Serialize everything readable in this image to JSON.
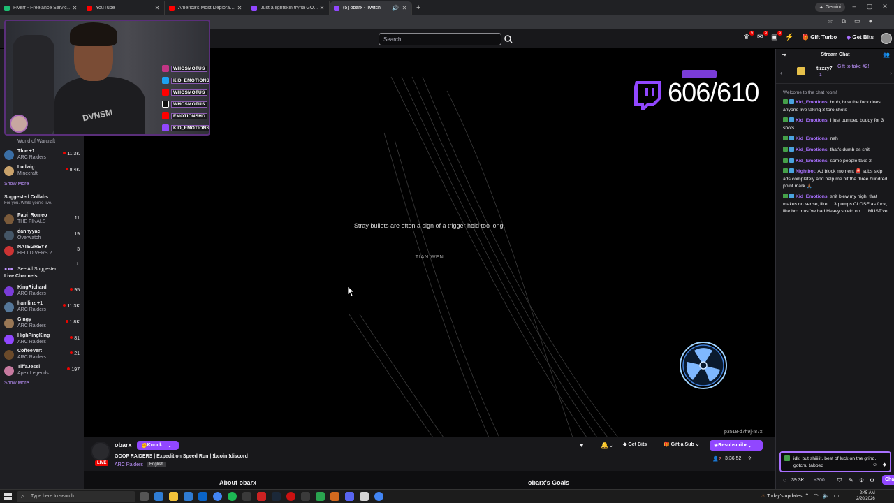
{
  "browser": {
    "tabs": [
      {
        "label": "Fiverr - Freelance Services Mark",
        "color": "#1dbf73",
        "active": false
      },
      {
        "label": "YouTube",
        "color": "#ff0000",
        "active": false
      },
      {
        "label": "America's Most Deplorable Affi",
        "color": "#ff0000",
        "active": false
      },
      {
        "label": "Just a lightskin tryna GOOOOO",
        "color": "#9147ff",
        "active": false
      },
      {
        "label": "(5) obarx - Twitch",
        "color": "#9147ff",
        "active": true
      }
    ],
    "gemini_label": "Gemini"
  },
  "nav": {
    "search_placeholder": "Search",
    "badges": [
      "6",
      "5",
      "6"
    ],
    "gift_turbo": "Gift Turbo",
    "get_bits": "Get Bits"
  },
  "sidebar": {
    "channels_top": [
      {
        "name": "",
        "game": "World of Warcraft",
        "viewers": "",
        "color": "#555"
      },
      {
        "name": "Tfue +1",
        "game": "ARC Raiders",
        "viewers": "11.3K",
        "color": "#3a6ea5"
      },
      {
        "name": "Ludwig",
        "game": "Minecraft",
        "viewers": "8.4K",
        "color": "#c9a26b"
      }
    ],
    "show_more_1": "Show More",
    "suggested_title": "Suggested Collabs",
    "suggested_sub": "For you. While you're live.",
    "suggested": [
      {
        "name": "Papi_Romeo",
        "game": "THE FINALS",
        "viewers": "11",
        "color": "#7a5a3a"
      },
      {
        "name": "dannyyac",
        "game": "Overwatch",
        "viewers": "19",
        "color": "#445566"
      },
      {
        "name": "NATEGREYY",
        "game": "HELLDIVERS 2",
        "viewers": "3",
        "color": "#cc3333"
      }
    ],
    "see_all_suggested": "See All Suggested",
    "live_title": "Live Channels",
    "live": [
      {
        "name": "KingRichard",
        "game": "ARC Raiders",
        "viewers": "95",
        "color": "#7a3cd8"
      },
      {
        "name": "hamlinz +1",
        "game": "ARC Raiders",
        "viewers": "11.3K",
        "color": "#557799"
      },
      {
        "name": "Gingy",
        "game": "ARC Raiders",
        "viewers": "1.8K",
        "color": "#997755"
      },
      {
        "name": "HighPingKing",
        "game": "ARC Raiders",
        "viewers": "81",
        "color": "#9147ff"
      },
      {
        "name": "CoffeeVert",
        "game": "ARC Raiders",
        "viewers": "21",
        "color": "#6b4a2a"
      },
      {
        "name": "TiffaJessi",
        "game": "Apex Legends",
        "viewers": "197",
        "color": "#c77aa0"
      }
    ],
    "show_more_2": "Show More"
  },
  "webcam": {
    "socials": [
      "WHOSMOTUS",
      "KID_EMOTIONS",
      "WHOSMOTUS",
      "WHOSMOTUS",
      "EMOTIONSHD",
      "KID_EMOTIONS"
    ],
    "social_colors": [
      "#c13584",
      "#1da1f2",
      "#ff0000",
      "#111111",
      "#ff0000",
      "#9147ff"
    ],
    "shirt": "DVNSM"
  },
  "player": {
    "quote": "Stray bullets are often a sign of a trigger held too long.",
    "author": "TIAN WEN",
    "sub_counter": "606/610",
    "stream_code": "p3518-d7h9j-I87xl"
  },
  "stream": {
    "channel": "obarx",
    "knock": "Knock",
    "live": "LIVE",
    "title": "GOOP RAIDERS | Expedition Speed Run | !bcoin !discord",
    "game": "ARC Raiders",
    "language": "English",
    "get_bits": "Get Bits",
    "gift_sub": "Gift a Sub",
    "resubscribe": "Resubscribe",
    "viewers": "2",
    "uptime": "3:36:52",
    "about": "About obarx",
    "goals": "obarx's Goals"
  },
  "chat": {
    "header": "Stream Chat",
    "pinned_user": "tizzzy7",
    "pinned_gift": "Gift to take #2!",
    "pinned_count": "1",
    "welcome": "Welcome to the chat room!",
    "messages": [
      {
        "user": "Kid_Emotions",
        "text": ": bruh, how the fuck does anyone live taking 3 toro shots",
        "color": "#a970ff"
      },
      {
        "user": "Kid_Emotions",
        "text": ": I just pumped buddy for 3 shots",
        "color": "#a970ff"
      },
      {
        "user": "Kid_Emotions",
        "text": ": nah",
        "color": "#a970ff"
      },
      {
        "user": "Kid_Emotions",
        "text": ": that's dumb as shit",
        "color": "#a970ff"
      },
      {
        "user": "Kid_Emotions",
        "text": ": some people take 2",
        "color": "#a970ff"
      },
      {
        "user": "Nightbot",
        "text": ": Ad block moment 🚨 subs skip ads completely and help me hit the three hundred point mark 🙏🏾",
        "color": "#a970ff"
      },
      {
        "user": "Kid_Emotions",
        "text": ": shit blew my high, that makes no sense, like.... 3 pumps CLOSE as fuck, like bro must've had Heavy shield on .... MUST've",
        "color": "#a970ff"
      }
    ],
    "input_value": "idk. but shiiiiit, best of luck on the grind, gotchu tabbed",
    "points": "39.3K",
    "points_bonus": "+300",
    "chat_button": "Chat"
  },
  "taskbar": {
    "search_placeholder": "Type here to search",
    "updates": "Today's updates",
    "time": "2:45 AM",
    "date": "2/20/2026",
    "app_colors": [
      "#ffb347",
      "#555",
      "#2f7cd3",
      "#f3c33a",
      "#2f7cd3",
      "#0a64c8",
      "#4285f4",
      "#1db954",
      "#1b2838",
      "#2a2a2a",
      "#cc2222",
      "#1b2838",
      "#cc1111",
      "#3a3a3a",
      "#2aa44f",
      "#d2691e",
      "#5865f2",
      "#d4d4d4",
      "#4285f4"
    ]
  }
}
